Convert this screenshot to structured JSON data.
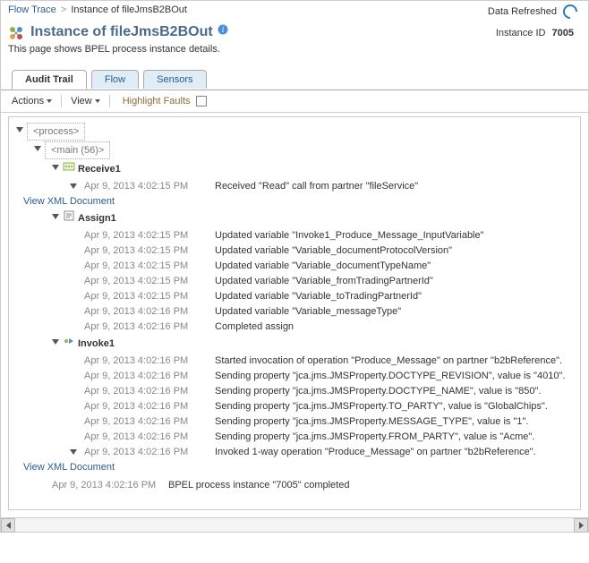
{
  "breadcrumb": {
    "parent": "Flow Trace",
    "current": "Instance of fileJmsB2BOut"
  },
  "data_refreshed": "Data Refreshed",
  "title": "Instance of fileJmsB2BOut",
  "subtitle": "This page shows BPEL process instance details.",
  "instance_id": {
    "label": "Instance ID",
    "value": "7005"
  },
  "tabs": {
    "audit": "Audit Trail",
    "flow": "Flow",
    "sensors": "Sensors"
  },
  "toolbar": {
    "actions": "Actions",
    "view": "View",
    "highlight": "Highlight Faults"
  },
  "tree": {
    "process": "<process>",
    "main": "<main (56)>",
    "receive1": {
      "label": "Receive1",
      "view_xml": "View XML Document",
      "row": {
        "ts": "Apr 9, 2013 4:02:15 PM",
        "msg": "Received \"Read\" call from partner \"fileService\""
      }
    },
    "assign1": {
      "label": "Assign1",
      "rows": [
        {
          "ts": "Apr 9, 2013 4:02:15 PM",
          "msg": "Updated variable \"Invoke1_Produce_Message_InputVariable\""
        },
        {
          "ts": "Apr 9, 2013 4:02:15 PM",
          "msg": "Updated variable \"Variable_documentProtocolVersion\""
        },
        {
          "ts": "Apr 9, 2013 4:02:15 PM",
          "msg": "Updated variable \"Variable_documentTypeName\""
        },
        {
          "ts": "Apr 9, 2013 4:02:15 PM",
          "msg": "Updated variable \"Variable_fromTradingPartnerId\""
        },
        {
          "ts": "Apr 9, 2013 4:02:15 PM",
          "msg": "Updated variable \"Variable_toTradingPartnerId\""
        },
        {
          "ts": "Apr 9, 2013 4:02:16 PM",
          "msg": "Updated variable \"Variable_messageType\""
        },
        {
          "ts": "Apr 9, 2013 4:02:16 PM",
          "msg": "Completed assign"
        }
      ]
    },
    "invoke1": {
      "label": "Invoke1",
      "view_xml": "View XML Document",
      "rows": [
        {
          "ts": "Apr 9, 2013 4:02:16 PM",
          "msg": "Started invocation of operation \"Produce_Message\" on partner \"b2bReference\"."
        },
        {
          "ts": "Apr 9, 2013 4:02:16 PM",
          "msg": "Sending property \"jca.jms.JMSProperty.DOCTYPE_REVISION\", value is \"4010\"."
        },
        {
          "ts": "Apr 9, 2013 4:02:16 PM",
          "msg": "Sending property \"jca.jms.JMSProperty.DOCTYPE_NAME\", value is \"850\"."
        },
        {
          "ts": "Apr 9, 2013 4:02:16 PM",
          "msg": "Sending property \"jca.jms.JMSProperty.TO_PARTY\", value is \"GlobalChips\"."
        },
        {
          "ts": "Apr 9, 2013 4:02:16 PM",
          "msg": "Sending property \"jca.jms.JMSProperty.MESSAGE_TYPE\", value is \"1\"."
        },
        {
          "ts": "Apr 9, 2013 4:02:16 PM",
          "msg": "Sending property \"jca.jms.JMSProperty.FROM_PARTY\", value is \"Acme\"."
        },
        {
          "ts": "Apr 9, 2013 4:02:16 PM",
          "msg": "Invoked 1-way operation \"Produce_Message\" on partner \"b2bReference\"."
        }
      ]
    },
    "final": {
      "ts": "Apr 9, 2013 4:02:16 PM",
      "msg": "BPEL process instance \"7005\" completed"
    }
  }
}
